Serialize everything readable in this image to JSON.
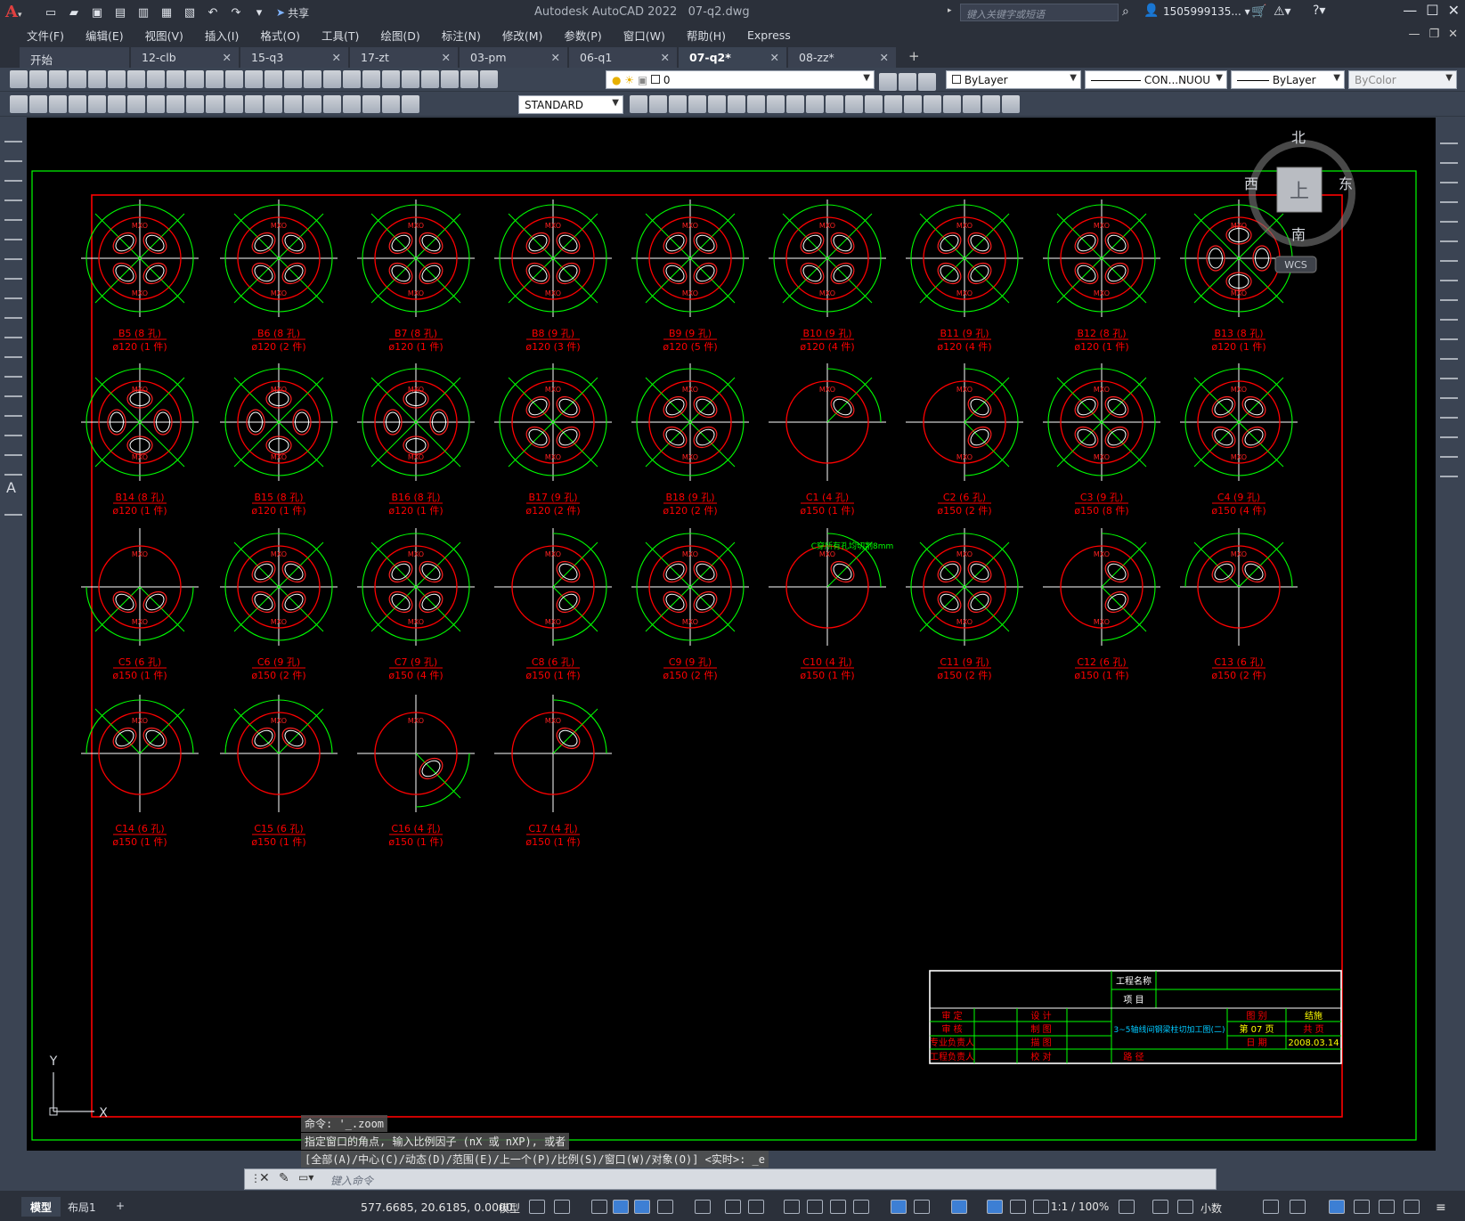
{
  "app": {
    "title": "Autodesk AutoCAD 2022",
    "filename": "07-q2.dwg",
    "share_label": "共享",
    "search_placeholder": "键入关键字或短语",
    "user": "1505999135...",
    "logo_letter": "A"
  },
  "menu": [
    "文件(F)",
    "编辑(E)",
    "视图(V)",
    "插入(I)",
    "格式(O)",
    "工具(T)",
    "绘图(D)",
    "标注(N)",
    "修改(M)",
    "参数(P)",
    "窗口(W)",
    "帮助(H)",
    "Express"
  ],
  "tabs": [
    {
      "label": "开始",
      "active": false,
      "closable": false
    },
    {
      "label": "12-clb",
      "active": false,
      "closable": true
    },
    {
      "label": "15-q3",
      "active": false,
      "closable": true
    },
    {
      "label": "17-zt",
      "active": false,
      "closable": true
    },
    {
      "label": "03-pm",
      "active": false,
      "closable": true
    },
    {
      "label": "06-q1",
      "active": false,
      "closable": true
    },
    {
      "label": "07-q2*",
      "active": true,
      "closable": true
    },
    {
      "label": "08-zz*",
      "active": false,
      "closable": true
    }
  ],
  "toolbar": {
    "layer_value": "0",
    "color_value": "ByLayer",
    "linetype_value": "CON...NUOU",
    "lineweight_value": "ByLayer",
    "plotstyle_value": "ByColor",
    "textstyle_value": "STANDARD"
  },
  "viewcube": {
    "north": "北",
    "south": "南",
    "east": "东",
    "west": "西",
    "top": "上",
    "ucs": "WCS"
  },
  "drawing": {
    "hole_label": "MXO",
    "note": "C穿所有孔均切割8mm",
    "ucs_x": "X",
    "ucs_y": "Y",
    "items": [
      {
        "name": "B5 (8 孔)",
        "spec": "ø120 (1 件)",
        "kind": "full4"
      },
      {
        "name": "B6 (8 孔)",
        "spec": "ø120 (2 件)",
        "kind": "full4"
      },
      {
        "name": "B7 (8 孔)",
        "spec": "ø120 (1 件)",
        "kind": "full4"
      },
      {
        "name": "B8 (9 孔)",
        "spec": "ø120 (3 件)",
        "kind": "full4"
      },
      {
        "name": "B9 (9 孔)",
        "spec": "ø120 (5 件)",
        "kind": "full4"
      },
      {
        "name": "B10 (9 孔)",
        "spec": "ø120 (4 件)",
        "kind": "full4"
      },
      {
        "name": "B11 (9 孔)",
        "spec": "ø120 (4 件)",
        "kind": "full4"
      },
      {
        "name": "B12 (8 孔)",
        "spec": "ø120 (1 件)",
        "kind": "full4"
      },
      {
        "name": "B13 (8 孔)",
        "spec": "ø120 (1 件)",
        "kind": "full4v"
      },
      {
        "name": "B14 (8 孔)",
        "spec": "ø120 (1 件)",
        "kind": "full4v"
      },
      {
        "name": "B15 (8 孔)",
        "spec": "ø120 (1 件)",
        "kind": "full4v"
      },
      {
        "name": "B16 (8 孔)",
        "spec": "ø120 (1 件)",
        "kind": "full4v"
      },
      {
        "name": "B17 (9 孔)",
        "spec": "ø120 (2 件)",
        "kind": "full4"
      },
      {
        "name": "B18 (9 孔)",
        "spec": "ø120 (2 件)",
        "kind": "full4"
      },
      {
        "name": "C1 (4 孔)",
        "spec": "ø150 (1 件)",
        "kind": "quarter1"
      },
      {
        "name": "C2 (6 孔)",
        "spec": "ø150 (2 件)",
        "kind": "right2"
      },
      {
        "name": "C3 (9 孔)",
        "spec": "ø150 (8 件)",
        "kind": "full4"
      },
      {
        "name": "C4 (9 孔)",
        "spec": "ø150 (4 件)",
        "kind": "full4"
      },
      {
        "name": "C5 (6 孔)",
        "spec": "ø150 (1 件)",
        "kind": "bottom2"
      },
      {
        "name": "C6 (9 孔)",
        "spec": "ø150 (2 件)",
        "kind": "full4"
      },
      {
        "name": "C7 (9 孔)",
        "spec": "ø150 (4 件)",
        "kind": "full4"
      },
      {
        "name": "C8 (6 孔)",
        "spec": "ø150 (1 件)",
        "kind": "right2"
      },
      {
        "name": "C9 (9 孔)",
        "spec": "ø150 (2 件)",
        "kind": "full4"
      },
      {
        "name": "C10 (4 孔)",
        "spec": "ø150 (1 件)",
        "kind": "quarter1"
      },
      {
        "name": "C11 (9 孔)",
        "spec": "ø150 (2 件)",
        "kind": "full4"
      },
      {
        "name": "C12 (6 孔)",
        "spec": "ø150 (1 件)",
        "kind": "right2"
      },
      {
        "name": "C13 (6 孔)",
        "spec": "ø150 (2 件)",
        "kind": "top2"
      },
      {
        "name": "C14 (6 孔)",
        "spec": "ø150 (1 件)",
        "kind": "top2"
      },
      {
        "name": "C15 (6 孔)",
        "spec": "ø150 (1 件)",
        "kind": "top2"
      },
      {
        "name": "C16 (4 孔)",
        "spec": "ø150 (1 件)",
        "kind": "quarter4"
      },
      {
        "name": "C17 (4 孔)",
        "spec": "ø150 (1 件)",
        "kind": "quarter1"
      }
    ]
  },
  "titleblock": {
    "project_name_label": "工程名称",
    "item_label": "项    目",
    "rows": [
      [
        "审    定",
        "设    计"
      ],
      [
        "审    核",
        "制    图"
      ],
      [
        "专业负责人",
        "描    图"
      ],
      [
        "工程负责人",
        "校    对"
      ]
    ],
    "drawing_title": "3~5轴线间钢梁柱切加工图(二)",
    "category_label": "图    别",
    "category_value": "结施",
    "sheet_label": "第 07 页",
    "total_label": "共    页",
    "date_label": "日    期",
    "date_value": "2008.03.14",
    "path_label": "路    径"
  },
  "command": {
    "line1": "命令: '_.zoom",
    "line2": "指定窗口的角点, 输入比例因子 (nX 或 nXP), 或者",
    "line3": "[全部(A)/中心(C)/动态(D)/范围(E)/上一个(P)/比例(S)/窗口(W)/对象(O)] <实时>: _e",
    "placeholder": "键入命令"
  },
  "status": {
    "model_tab": "模型",
    "layout_tab": "布局1",
    "coords": "577.6685, 20.6185, 0.0000",
    "space": "模型",
    "scale": "1:1 / 100%",
    "units": "小数"
  }
}
